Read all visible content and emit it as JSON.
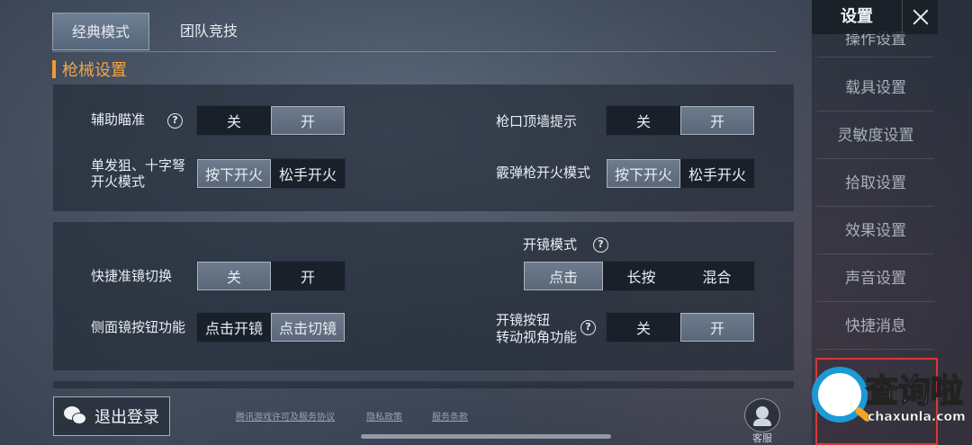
{
  "tabs": [
    {
      "label": "经典模式",
      "active": true
    },
    {
      "label": "团队竞技",
      "active": false
    }
  ],
  "section_title": "枪械设置",
  "settings": {
    "aim_assist": {
      "label": "辅助瞄准",
      "help": "?",
      "options": [
        "关",
        "开"
      ],
      "selected": 1
    },
    "muzzle_wall": {
      "label": "枪口顶墙提示",
      "options": [
        "关",
        "开"
      ],
      "selected": 1
    },
    "sniper_fire": {
      "label_line1": "单发狙、十字弩",
      "label_line2": "开火模式",
      "options": [
        "按下开火",
        "松手开火"
      ],
      "selected": 0
    },
    "shotgun_fire": {
      "label": "霰弹枪开火模式",
      "options": [
        "按下开火",
        "松手开火"
      ],
      "selected": 0
    },
    "quick_scope": {
      "label": "快捷准镜切换",
      "options": [
        "关",
        "开"
      ],
      "selected": 0
    },
    "scope_mode": {
      "label": "开镜模式",
      "help": "?",
      "options": [
        "点击",
        "长按",
        "混合"
      ],
      "selected": 0
    },
    "side_scope": {
      "label": "侧面镜按钮功能",
      "options": [
        "点击开镜",
        "点击切镜"
      ],
      "selected": 1
    },
    "scope_button_view": {
      "label_line1": "开镜按钮",
      "label_line2": "转动视角功能",
      "help": "?",
      "options": [
        "关",
        "开"
      ],
      "selected": 1
    }
  },
  "sidebar": {
    "title": "设置",
    "close_icon": "close-icon",
    "items": [
      "操作设置",
      "载具设置",
      "灵敏度设置",
      "拾取设置",
      "效果设置",
      "声音设置",
      "快捷消息"
    ]
  },
  "bottom": {
    "logout_label": "退出登录",
    "links": [
      "腾讯游戏许可及服务协议",
      "隐私政策",
      "服务条款"
    ],
    "service_label": "客服"
  },
  "watermark": {
    "brand": "查询啦",
    "url": "chaxunla.com"
  },
  "colors": {
    "accent": "#f19b2c",
    "highlight_border": "#d8383a",
    "watermark_blue": "#1c9ad6"
  }
}
